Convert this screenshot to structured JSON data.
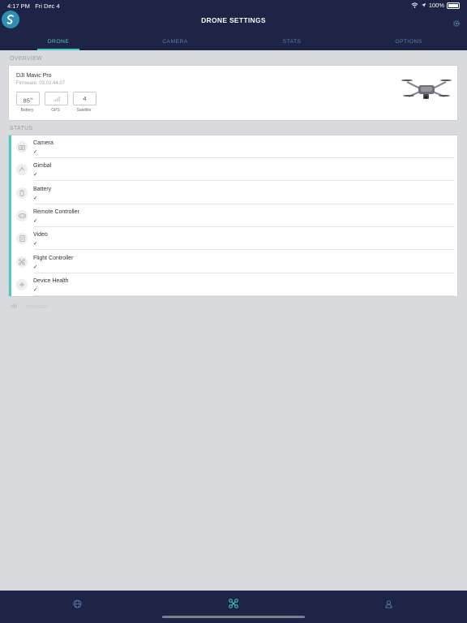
{
  "status_bar": {
    "time": "4:17 PM",
    "date": "Fri Dec 4",
    "battery": "100%"
  },
  "header": {
    "title": "DRONE SETTINGS"
  },
  "tabs": [
    {
      "label": "DRONE",
      "active": true
    },
    {
      "label": "CAMERA",
      "active": false
    },
    {
      "label": "STATS",
      "active": false
    },
    {
      "label": "OPTIONS",
      "active": false
    }
  ],
  "overview": {
    "section_label": "OVERVIEW",
    "drone_name": "DJI Mavic Pro",
    "firmware": "Firmware: 03.02.44.07",
    "battery_value": "85",
    "battery_unit": "%",
    "battery_label": "Battery",
    "gps_label": "GPS",
    "satellite_value": "4",
    "satellite_label": "Satellite"
  },
  "status": {
    "section_label": "STATUS",
    "items": [
      {
        "label": "Camera",
        "check": "✓",
        "icon": "camera-icon"
      },
      {
        "label": "Gimbal",
        "check": "✓",
        "icon": "gimbal-icon"
      },
      {
        "label": "Battery",
        "check": "✓",
        "icon": "battery-icon"
      },
      {
        "label": "Remote Controller",
        "check": "✓",
        "icon": "controller-icon"
      },
      {
        "label": "Video",
        "check": "✓",
        "icon": "video-icon"
      },
      {
        "label": "Flight Controller",
        "check": "✓",
        "icon": "flight-controller-icon"
      },
      {
        "label": "Device Health",
        "check": "✓",
        "icon": "device-health-icon"
      }
    ]
  },
  "footer_brand": {
    "logo": "dji",
    "text": "POWERED"
  },
  "bottom_nav": [
    "globe-icon",
    "drone-icon",
    "user-icon"
  ],
  "colors": {
    "header_bg": "#1e2446",
    "accent": "#4cc9c4",
    "tab_inactive": "#5a7dab",
    "page_bg": "#d9dadd"
  }
}
